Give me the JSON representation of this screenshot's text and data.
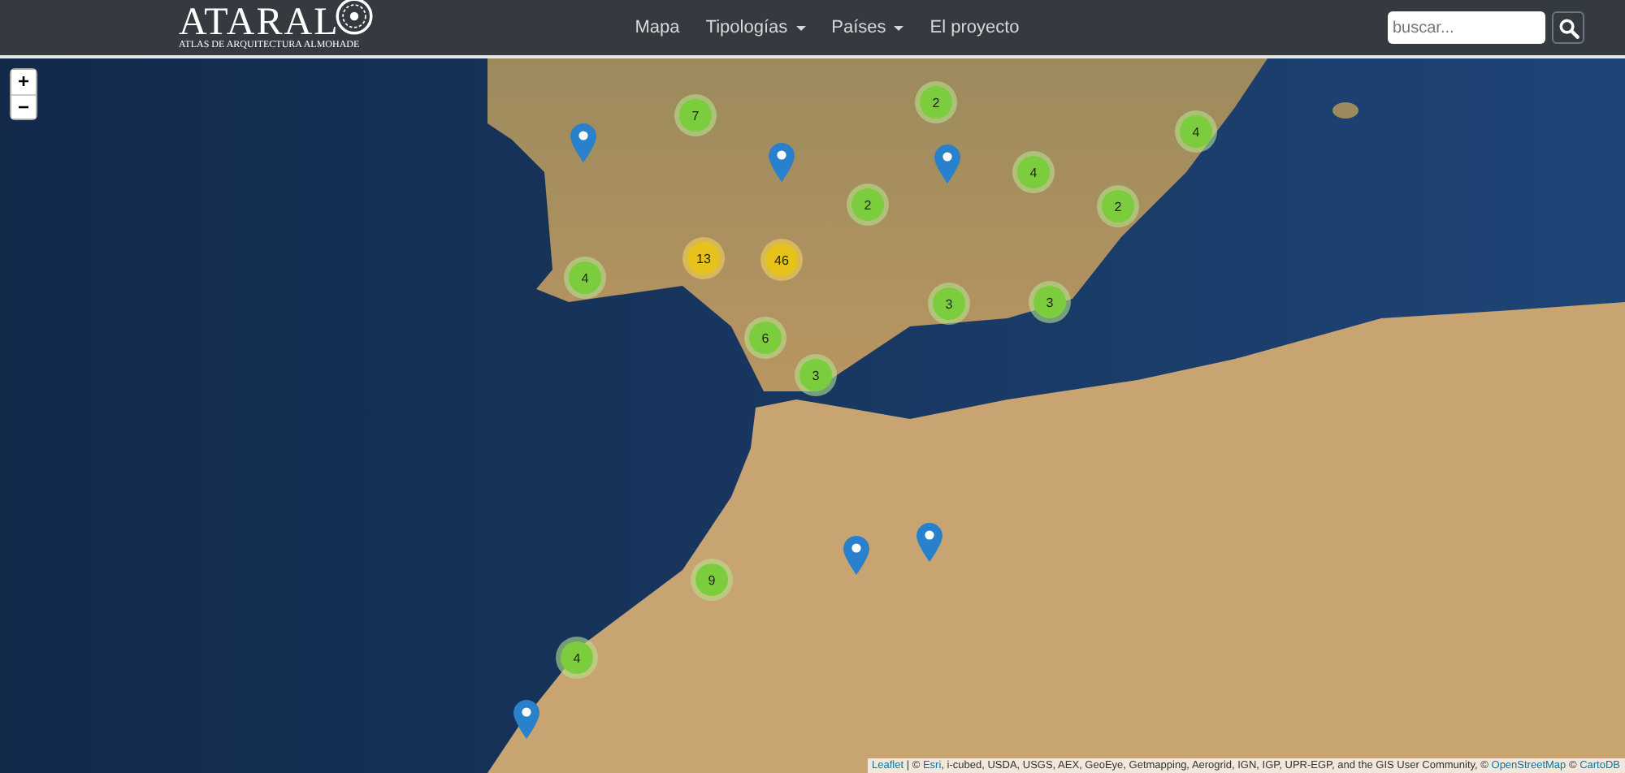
{
  "header": {
    "logo": {
      "title": "ATARAL",
      "subtitle": "ATLAS DE ARQUITECTURA ALMOHADE"
    },
    "nav": [
      {
        "label": "Mapa",
        "dropdown": false
      },
      {
        "label": "Tipologías",
        "dropdown": true
      },
      {
        "label": "Países",
        "dropdown": true
      },
      {
        "label": "El proyecto",
        "dropdown": false
      }
    ],
    "search": {
      "placeholder": "buscar..."
    }
  },
  "map": {
    "zoom_controls": [
      "+",
      "−"
    ],
    "clusters": [
      {
        "count": "7",
        "kind": "small"
      },
      {
        "count": "2",
        "kind": "small"
      },
      {
        "count": "4",
        "kind": "small"
      },
      {
        "count": "4",
        "kind": "small"
      },
      {
        "count": "2",
        "kind": "small"
      },
      {
        "count": "2",
        "kind": "small"
      },
      {
        "count": "4",
        "kind": "small"
      },
      {
        "count": "13",
        "kind": "medium"
      },
      {
        "count": "46",
        "kind": "medium"
      },
      {
        "count": "3",
        "kind": "small"
      },
      {
        "count": "3",
        "kind": "small"
      },
      {
        "count": "6",
        "kind": "small"
      },
      {
        "count": "3",
        "kind": "small"
      },
      {
        "count": "9",
        "kind": "small"
      },
      {
        "count": "4",
        "kind": "small"
      }
    ],
    "attribution": [
      {
        "text": "Leaflet",
        "link": true
      },
      {
        "text": " | © ",
        "link": false
      },
      {
        "text": "Esri",
        "link": true
      },
      {
        "text": ", i-cubed, USDA, USGS, AEX, GeoEye, Getmapping, Aerogrid, IGN, IGP, UPR-EGP, and the GIS User Community, © ",
        "link": false
      },
      {
        "text": "OpenStreetMap",
        "link": true
      },
      {
        "text": " © ",
        "link": false
      },
      {
        "text": "CartoDB",
        "link": true
      }
    ]
  }
}
